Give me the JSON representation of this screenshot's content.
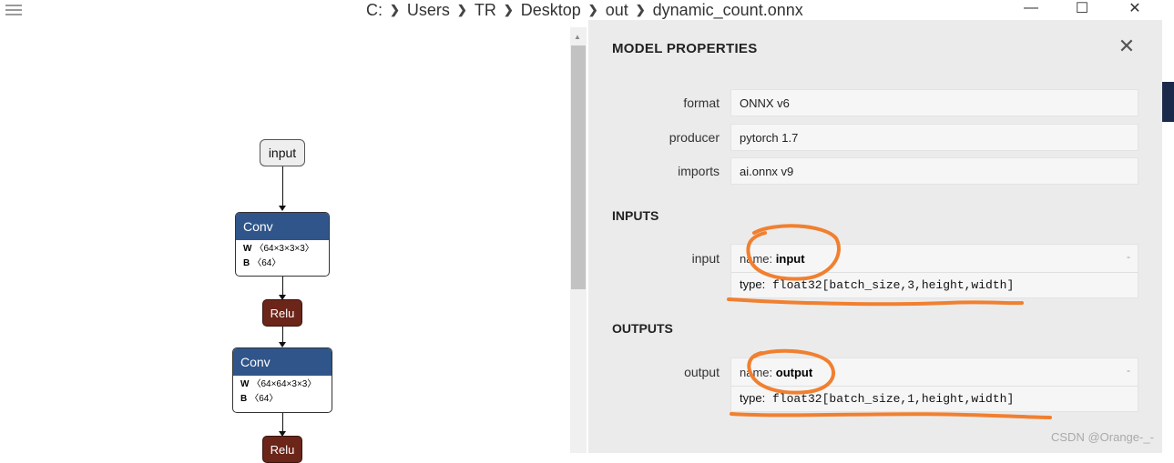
{
  "breadcrumb": {
    "items": [
      "C:",
      "Users",
      "TR",
      "Desktop",
      "out",
      "dynamic_count.onnx"
    ]
  },
  "window": {
    "minimize_glyph": "—",
    "maximize_glyph": "☐",
    "close_glyph": "✕"
  },
  "graph": {
    "input_node": "input",
    "conv1": {
      "title": "Conv",
      "w_label": "W",
      "w_shape": "〈64×3×3×3〉",
      "b_label": "B",
      "b_shape": "〈64〉"
    },
    "relu1": "Relu",
    "conv2": {
      "title": "Conv",
      "w_label": "W",
      "w_shape": "〈64×64×3×3〉",
      "b_label": "B",
      "b_shape": "〈64〉"
    },
    "relu2": "Relu"
  },
  "panel": {
    "title": "MODEL PROPERTIES",
    "close_glyph": "✕",
    "properties": [
      {
        "label": "format",
        "value": "ONNX v6"
      },
      {
        "label": "producer",
        "value": "pytorch 1.7"
      },
      {
        "label": "imports",
        "value": "ai.onnx v9"
      }
    ],
    "inputs_title": "INPUTS",
    "input": {
      "label": "input",
      "name_prefix": "name:",
      "name": "input",
      "type_prefix": "type:",
      "type_value": "float32[batch_size,3,height,width]",
      "expand": "-"
    },
    "outputs_title": "OUTPUTS",
    "output": {
      "label": "output",
      "name_prefix": "name:",
      "name": "output",
      "type_prefix": "type:",
      "type_value": "float32[batch_size,1,height,width]",
      "expand": "-"
    }
  },
  "watermark": "CSDN @Orange-_-",
  "colors": {
    "conv_header": "#30558a",
    "relu": "#6b2519",
    "annotation": "#f08030",
    "panel_bg": "#ebebeb"
  }
}
